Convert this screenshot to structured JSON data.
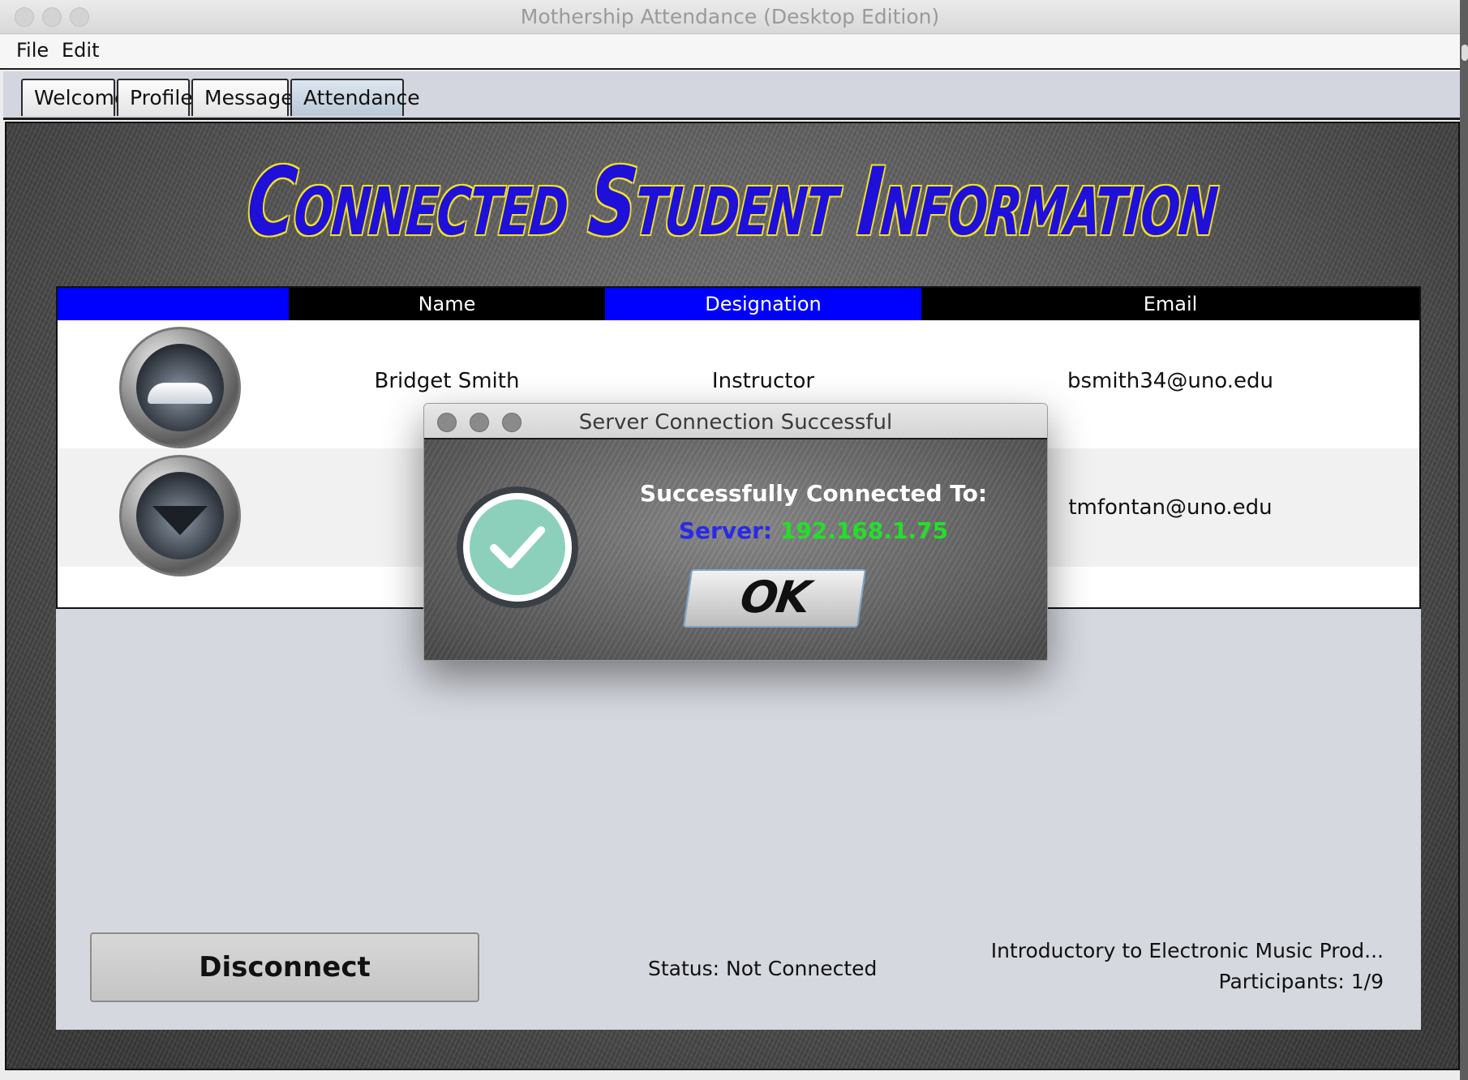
{
  "window": {
    "title": "Mothership Attendance (Desktop Edition)"
  },
  "menu": {
    "items": [
      "File",
      "Edit"
    ]
  },
  "tabs": [
    {
      "label": "Welcome",
      "active": false
    },
    {
      "label": "Profile",
      "active": false
    },
    {
      "label": "Messages",
      "active": false
    },
    {
      "label": "Attendance",
      "active": true
    }
  ],
  "heading": "Connected Student Information",
  "table": {
    "columns": [
      "",
      "Name",
      "Designation",
      "Email"
    ],
    "header_colors": [
      "#0000ff",
      "#000000",
      "#0000ff",
      "#000000"
    ],
    "rows": [
      {
        "avatar": "car-avatar",
        "name": "Bridget Smith",
        "designation": "Instructor",
        "email": "bsmith34@uno.edu"
      },
      {
        "avatar": "jet-avatar",
        "name": "",
        "designation": "",
        "email": "tmfontan@uno.edu"
      }
    ]
  },
  "footer": {
    "disconnect_label": "Disconnect",
    "status": "Status: Not Connected",
    "course": "Introductory to Electronic Music Prod...",
    "participants": "Participants: 1/9"
  },
  "dialog": {
    "title": "Server Connection Successful",
    "message": "Successfully Connected To:",
    "server_label": "Server:",
    "server_value": "192.168.1.75",
    "ok_label": "OK",
    "icon": "check-circle-icon"
  }
}
